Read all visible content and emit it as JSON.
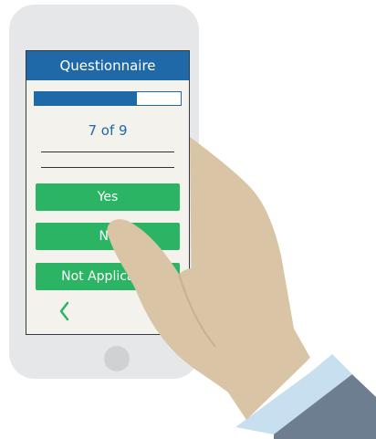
{
  "app": {
    "title": "Questionnaire"
  },
  "progress": {
    "current": 7,
    "total": 9,
    "fraction": 0.7,
    "label": "7 of 9"
  },
  "answers": [
    {
      "label": "Yes"
    },
    {
      "label": "No"
    },
    {
      "label": "Not Applicable"
    }
  ],
  "icons": {
    "back": "chevron-left-icon",
    "home": "home-button"
  },
  "colors": {
    "header": "#1f69a8",
    "answer": "#2bb463",
    "screen": "#f3f2ec",
    "phone": "#e6e7e8",
    "skin": "#d9c4a5",
    "cuff": "#c8dff0",
    "sleeve": "#6d7e91"
  }
}
